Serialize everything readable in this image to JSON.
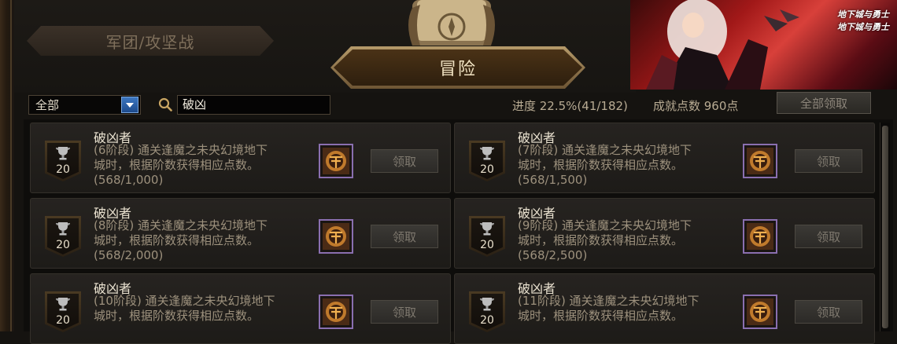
{
  "tabs": {
    "legion_label": "军团/攻坚战",
    "adventure_label": "冒险"
  },
  "banner": {
    "logo_text": "地下城与勇士"
  },
  "filter": {
    "category_value": "全部",
    "search_value": "破凶"
  },
  "stats": {
    "progress_text": "进度 22.5%(41/182)",
    "points_text": "成就点数 960点",
    "claim_all_label": "全部领取"
  },
  "achievements": [
    {
      "title": "破凶者",
      "points": "20",
      "line1": "(6阶段) 通关逢魔之未央幻境地下",
      "line2": "城时，根据阶数获得相应点数。",
      "line3": "(568/1,000)",
      "claim": "领取"
    },
    {
      "title": "破凶者",
      "points": "20",
      "line1": "(7阶段) 通关逢魔之未央幻境地下",
      "line2": "城时，根据阶数获得相应点数。",
      "line3": "(568/1,500)",
      "claim": "领取"
    },
    {
      "title": "破凶者",
      "points": "20",
      "line1": "(8阶段) 通关逢魔之未央幻境地下",
      "line2": "城时，根据阶数获得相应点数。",
      "line3": "(568/2,000)",
      "claim": "领取"
    },
    {
      "title": "破凶者",
      "points": "20",
      "line1": "(9阶段) 通关逢魔之未央幻境地下",
      "line2": "城时，根据阶数获得相应点数。",
      "line3": "(568/2,500)",
      "claim": "领取"
    },
    {
      "title": "破凶者",
      "points": "20",
      "line1": "(10阶段) 通关逢魔之未央幻境地下",
      "line2": "城时，根据阶数获得相应点数。",
      "line3": "",
      "claim": "领取"
    },
    {
      "title": "破凶者",
      "points": "20",
      "line1": "(11阶段) 通关逢魔之未央幻境地下",
      "line2": "城时，根据阶数获得相应点数。",
      "line3": "",
      "claim": "领取"
    }
  ],
  "colors": {
    "accent_gold": "#b59a6a",
    "reward_border": "#8a6fb0",
    "select_blue": "#3c76c0"
  },
  "icons": [
    "trophy-icon",
    "search-icon",
    "scroll-compass-icon",
    "reward-emblem-icon",
    "dropdown-arrow-icon"
  ]
}
